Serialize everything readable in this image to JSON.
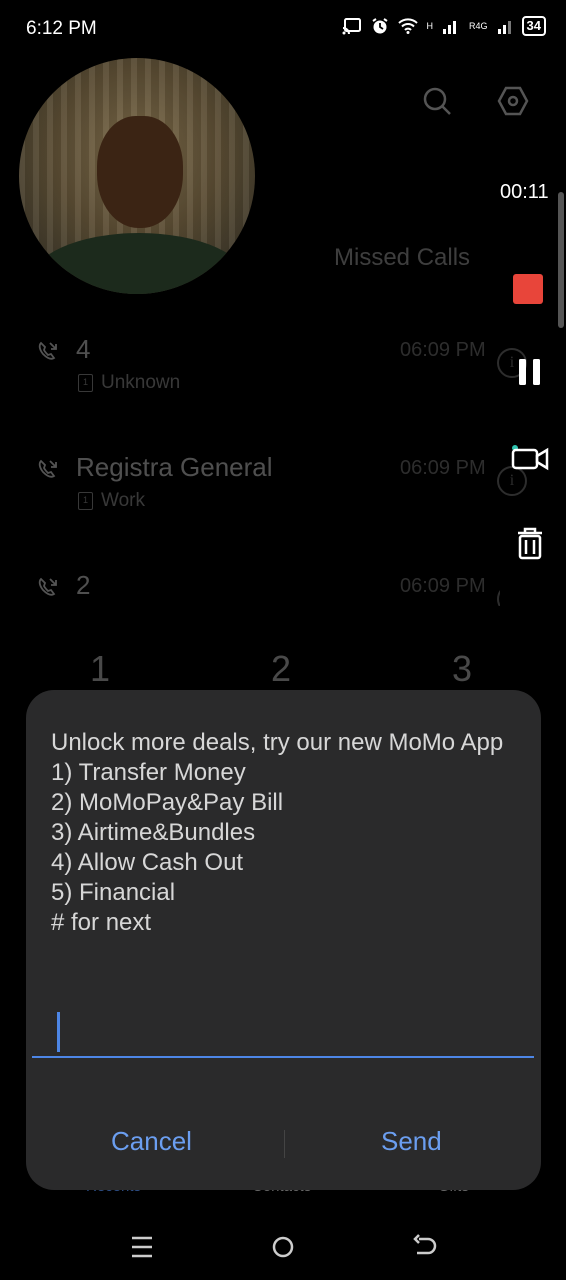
{
  "status_bar": {
    "time": "6:12 PM",
    "network_label": "R4G",
    "network_h": "H",
    "battery": "34",
    "icons": [
      "cast-icon",
      "alarm-icon",
      "wifi-icon",
      "signal-icon",
      "battery-icon"
    ]
  },
  "recorder": {
    "elapsed": "00:11",
    "controls": [
      "stop-icon",
      "pause-icon",
      "camera-icon",
      "trash-icon"
    ],
    "stop_color": "#e8453a"
  },
  "header": {
    "missed_calls": "Missed Calls",
    "icons": [
      "search-icon",
      "settings-icon"
    ]
  },
  "calls": [
    {
      "name": "4",
      "sub": "Unknown",
      "time": "06:09 PM"
    },
    {
      "name": "Registra General",
      "sub": "Work",
      "time": "06:09 PM"
    },
    {
      "name": "2",
      "sub": "",
      "time": "06:09 PM"
    }
  ],
  "keypad": {
    "digits": [
      "1",
      "2",
      "3"
    ]
  },
  "dialog": {
    "message": "Unlock more deals, try our new MoMo App\n1) Transfer Money\n2) MoMoPay&Pay Bill\n3) Airtime&Bundles\n4) Allow Cash Out\n5) Financial\n# for next",
    "input_value": "",
    "cancel_label": "Cancel",
    "send_label": "Send",
    "accent": "#6b9ef0"
  },
  "bottom_tabs": [
    "Recents",
    "Contacts",
    "Gifts"
  ],
  "nav": [
    "recents-menu-icon",
    "home-icon",
    "back-icon"
  ]
}
